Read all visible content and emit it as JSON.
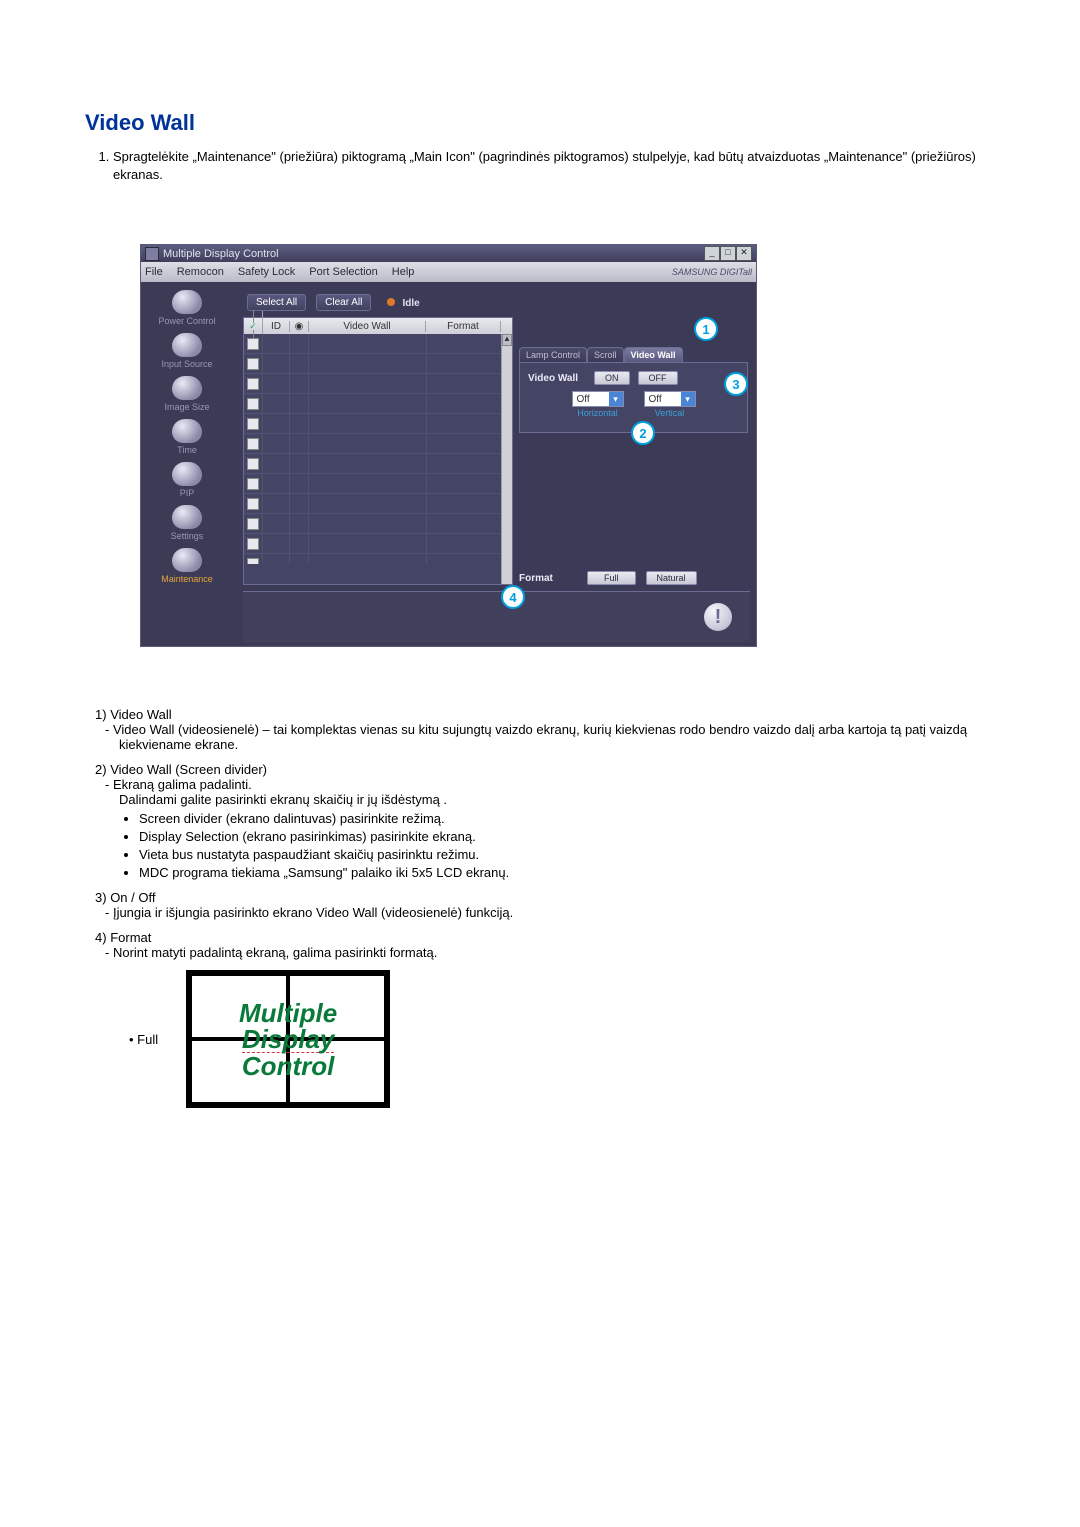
{
  "title": "Video Wall",
  "intro_item": "Spragtelėkite „Maintenance\" (priežiūra) piktogramą „Main Icon\" (pagrindinės piktogramos) stulpelyje, kad būtų atvaizduotas „Maintenance\" (priežiūros) ekranas.",
  "app": {
    "window_title": "Multiple Display Control",
    "menus": [
      "File",
      "Remocon",
      "Safety Lock",
      "Port Selection",
      "Help"
    ],
    "brand": "SAMSUNG DIGITall",
    "sidebar": [
      {
        "label": "Power Control"
      },
      {
        "label": "Input Source"
      },
      {
        "label": "Image Size"
      },
      {
        "label": "Time"
      },
      {
        "label": "PIP"
      },
      {
        "label": "Settings"
      },
      {
        "label": "Maintenance"
      }
    ],
    "toolbar": {
      "select_all": "Select All",
      "clear_all": "Clear All",
      "status": "Idle"
    },
    "grid": {
      "headers": {
        "id": "ID",
        "video_wall": "Video Wall",
        "format": "Format"
      }
    },
    "tabs": {
      "lamp": "Lamp Control",
      "scroll": "Scroll",
      "video_wall": "Video Wall"
    },
    "panel": {
      "video_wall_label": "Video Wall",
      "on": "ON",
      "off": "OFF",
      "h_val": "Off",
      "h_cap": "Horizontal",
      "v_val": "Off",
      "v_cap": "Vertical",
      "format_label": "Format",
      "full": "Full",
      "natural": "Natural"
    },
    "annotations": {
      "a1": "1",
      "a2": "2",
      "a3": "3",
      "a4": "4"
    }
  },
  "explain": {
    "i1": {
      "num": "1)",
      "head": "Video Wall",
      "dash": "Video Wall (videosienelė) – tai komplektas vienas su kitu sujungtų vaizdo ekranų, kurių kiekvienas rodo bendro vaizdo dalį arba kartoja tą patį vaizdą kiekviename ekrane."
    },
    "i2": {
      "num": "2)",
      "head": "Video Wall (Screen divider)",
      "dash": "Ekraną galima padalinti.",
      "line": "Dalindami galite pasirinkti ekranų skaičių ir jų išdėstymą .",
      "bullets": [
        "Screen divider (ekrano dalintuvas) pasirinkite režimą.",
        "Display Selection (ekrano pasirinkimas) pasirinkite ekraną.",
        "Vieta bus nustatyta paspaudžiant skaičių pasirinktu režimu.",
        "MDC programa tiekiama „Samsung\" palaiko iki 5x5 LCD ekranų."
      ]
    },
    "i3": {
      "num": "3)",
      "head": "On / Off",
      "dash": "Įjungia ir išjungia pasirinkto ekrano Video Wall (videosienelė) funkciją."
    },
    "i4": {
      "num": "4)",
      "head": "Format",
      "dash": "Norint matyti padalintą ekraną, galima pasirinkti formatą."
    },
    "full_label": "Full",
    "mdc": {
      "l1": "Multiple",
      "l2": "Display",
      "l3": "Control"
    }
  }
}
